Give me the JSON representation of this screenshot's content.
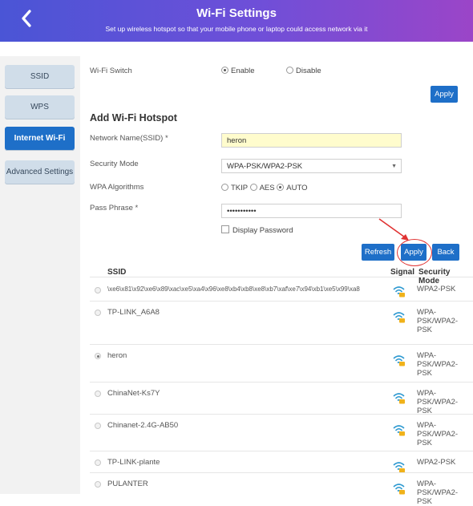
{
  "header": {
    "back_icon": "chevron-left-icon",
    "title": "Wi-Fi Settings",
    "subtitle": "Set up wireless hotspot so that your mobile phone or laptop could access network via it"
  },
  "sidebar": {
    "items": [
      {
        "label": "SSID",
        "active": false
      },
      {
        "label": "WPS",
        "active": false
      },
      {
        "label": "Internet Wi-Fi",
        "active": true
      },
      {
        "label": "Advanced Settings",
        "active": false
      }
    ]
  },
  "wifi_switch": {
    "label": "Wi-Fi Switch",
    "enable_label": "Enable",
    "disable_label": "Disable",
    "selected": "Enable",
    "apply_label": "Apply"
  },
  "hotspot": {
    "section_title": "Add Wi-Fi Hotspot",
    "ssid_label": "Network Name(SSID) *",
    "ssid_value": "heron",
    "security_label": "Security Mode",
    "security_value": "WPA-PSK/WPA2-PSK",
    "algorithms_label": "WPA Algorithms",
    "alg_tkip": "TKIP",
    "alg_aes": "AES",
    "alg_auto": "AUTO",
    "alg_selected": "AUTO",
    "pass_label": "Pass Phrase *",
    "pass_value": "•••••••••••",
    "display_password_label": "Display Password"
  },
  "actions": {
    "refresh_label": "Refresh",
    "apply_label": "Apply",
    "back_label": "Back"
  },
  "colors": {
    "accent": "#1e6fc8",
    "highlight": "#e03232"
  },
  "table": {
    "headers": {
      "ssid": "SSID",
      "signal": "Signal",
      "security": "Security Mode"
    },
    "rows": [
      {
        "ssid": "\\xe6\\x81\\x92\\xe6\\x89\\xac\\xe5\\xa4\\x96\\xe8\\xb4\\xb8\\xe8\\xb7\\xaf\\xe7\\x94\\xb1\\xe5\\x99\\xa8",
        "security": "WPA2-PSK",
        "selected": false,
        "signal_icon": "wifi-signal-icon"
      },
      {
        "ssid": "TP-LINK_A6A8",
        "security": "WPA-PSK/WPA2-PSK",
        "selected": false,
        "signal_icon": "wifi-signal-icon"
      },
      {
        "ssid": "heron",
        "security": "WPA-PSK/WPA2-PSK",
        "selected": true,
        "signal_icon": "wifi-signal-icon"
      },
      {
        "ssid": "ChinaNet-Ks7Y",
        "security": "WPA-PSK/WPA2-PSK",
        "selected": false,
        "signal_icon": "wifi-signal-icon"
      },
      {
        "ssid": "Chinanet-2.4G-AB50",
        "security": "WPA-PSK/WPA2-PSK",
        "selected": false,
        "signal_icon": "wifi-signal-icon"
      },
      {
        "ssid": "TP-LINK-plante",
        "security": "WPA2-PSK",
        "selected": false,
        "signal_icon": "wifi-signal-icon"
      },
      {
        "ssid": "PULANTER",
        "security": "WPA-PSK/WPA2-PSK",
        "selected": false,
        "signal_icon": "wifi-signal-icon"
      }
    ]
  }
}
